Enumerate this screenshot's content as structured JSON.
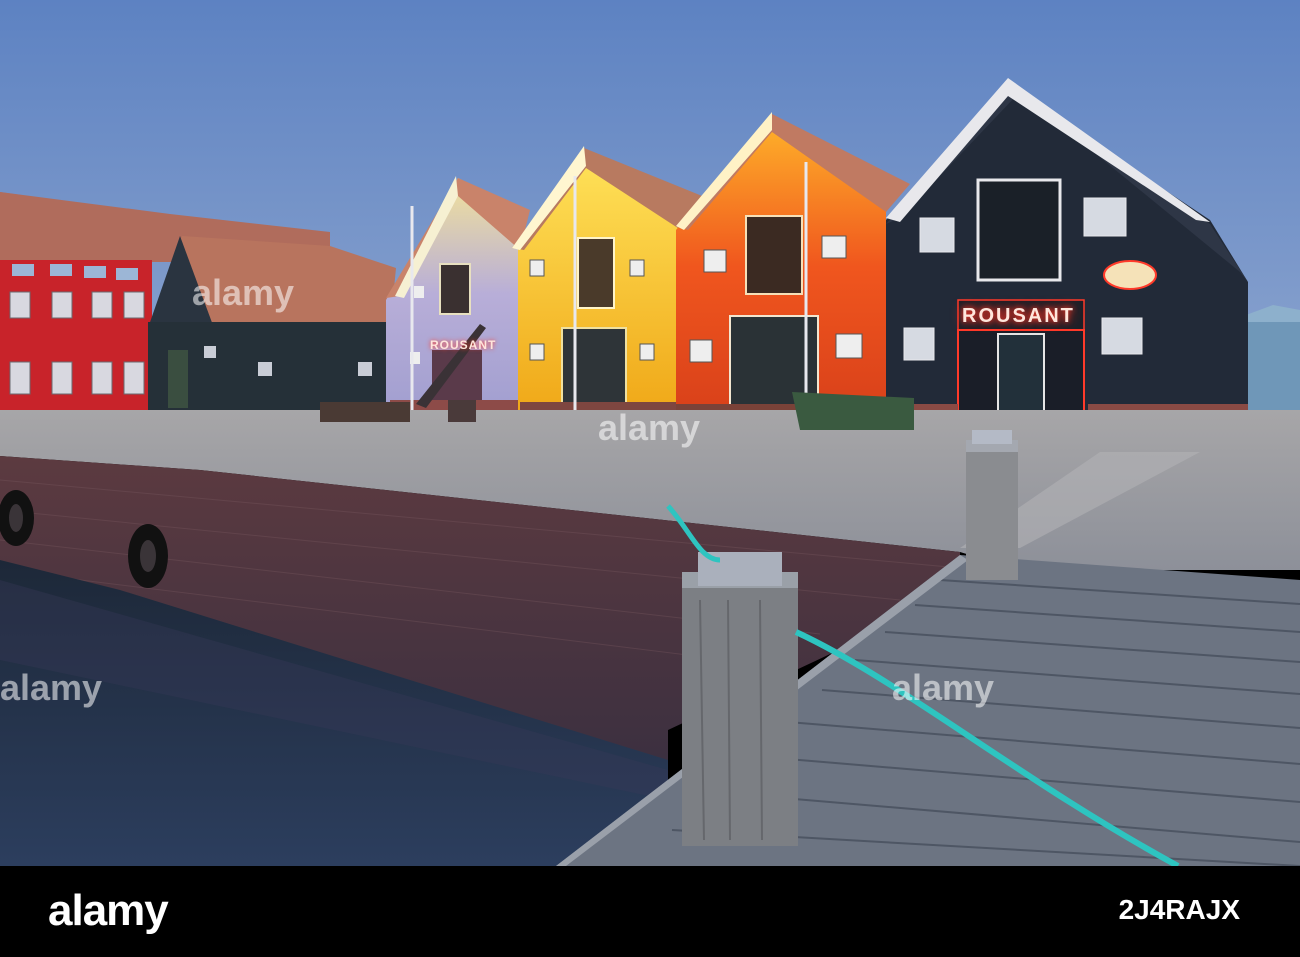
{
  "signs": {
    "main": "ROUSANT",
    "small": "ROUSANT"
  },
  "watermark": {
    "text": "alamy",
    "footer_logo": "alamy",
    "image_id": "2J4RAJX"
  }
}
